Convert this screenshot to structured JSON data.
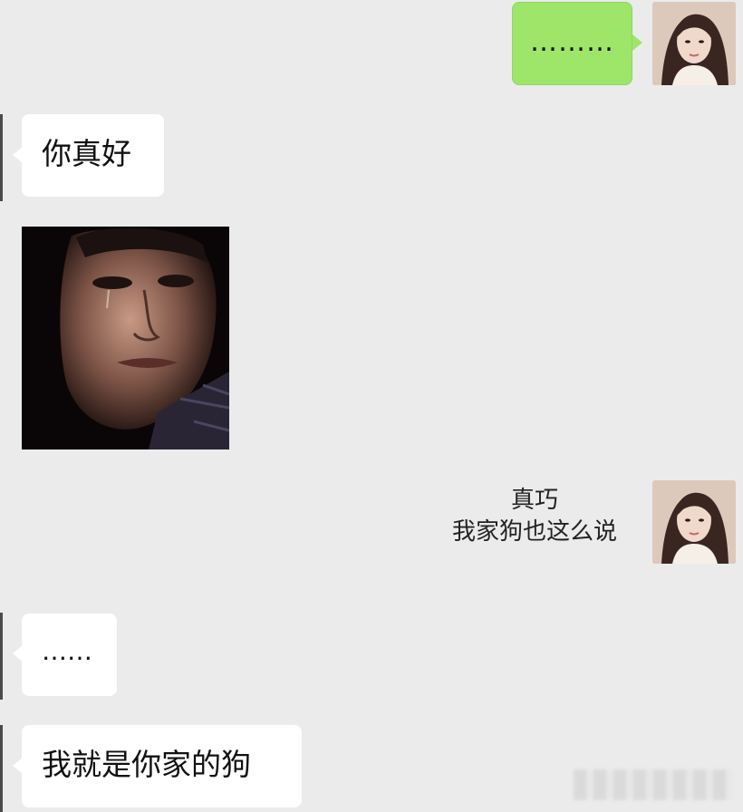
{
  "messages": [
    {
      "side": "right",
      "type": "text",
      "text": "………"
    },
    {
      "side": "left",
      "type": "text",
      "text": "你真好"
    },
    {
      "side": "left",
      "type": "image",
      "icon": "crying-man-photo"
    },
    {
      "side": "right",
      "type": "plain",
      "lines": [
        "真巧",
        "我家狗也这么说"
      ]
    },
    {
      "side": "left",
      "type": "text",
      "text": "……"
    },
    {
      "side": "left",
      "type": "text",
      "text": "我就是你家的狗"
    }
  ],
  "colors": {
    "background": "#ebebeb",
    "incoming_bubble": "#ffffff",
    "outgoing_bubble": "#9de66a"
  },
  "icons": {
    "avatar": "woman-avatar-icon"
  }
}
